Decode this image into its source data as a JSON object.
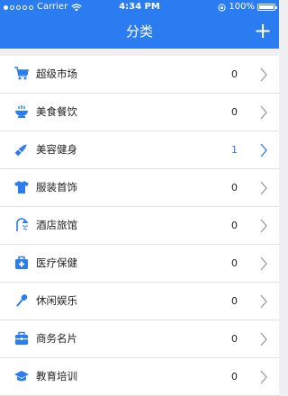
{
  "status_bar": {
    "carrier": "Carrier",
    "time": "4:34 PM",
    "battery": "100%"
  },
  "nav": {
    "title": "分类",
    "add_label": "+"
  },
  "accent_color": "#2b7cf0",
  "categories": [
    {
      "icon": "shopping-cart-icon",
      "label": "超级市场",
      "count": "0"
    },
    {
      "icon": "food-bowl-icon",
      "label": "美食餐饮",
      "count": "0"
    },
    {
      "icon": "lipstick-icon",
      "label": "美容健身",
      "count": "1",
      "active": true
    },
    {
      "icon": "tshirt-icon",
      "label": "服装首饰",
      "count": "0"
    },
    {
      "icon": "shower-icon",
      "label": "酒店旅馆",
      "count": "0"
    },
    {
      "icon": "medical-kit-icon",
      "label": "医疗保健",
      "count": "0"
    },
    {
      "icon": "microphone-icon",
      "label": "休闲娱乐",
      "count": "0"
    },
    {
      "icon": "briefcase-icon",
      "label": "商务名片",
      "count": "0"
    },
    {
      "icon": "graduation-cap-icon",
      "label": "教育培训",
      "count": "0"
    }
  ]
}
